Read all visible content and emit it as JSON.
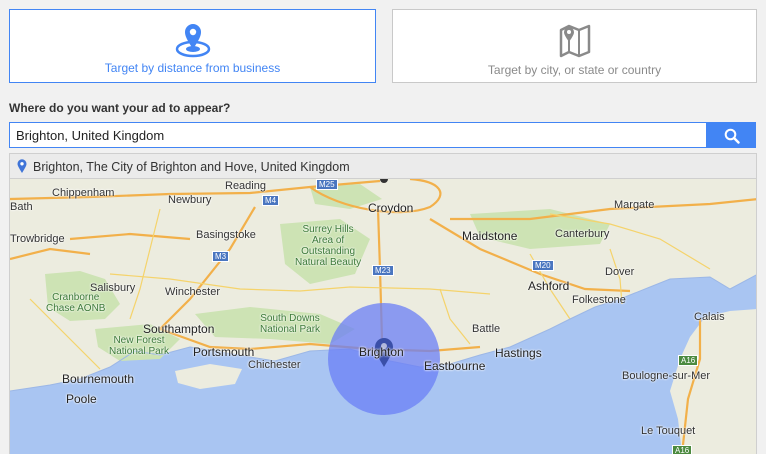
{
  "targeting": {
    "distance_label": "Target by distance from business",
    "city_label": "Target by city, or state or country",
    "active": "distance"
  },
  "question": "Where do you want your ad to appear?",
  "search": {
    "value": "Brighton, United Kingdom",
    "placeholder": ""
  },
  "suggestion": "Brighton, The City of Brighton and Hove, United Kingdom",
  "colors": {
    "accent": "#4285f4",
    "radius_fill": "#6b7ff5",
    "water": "#a9c5f2",
    "land": "#ececdf",
    "park": "#cde3b4"
  },
  "map": {
    "places": {
      "bath": "Bath",
      "chippenham": "Chippenham",
      "newbury": "Newbury",
      "reading": "Reading",
      "croydon": "Croydon",
      "margate": "Margate",
      "trowbridge": "Trowbridge",
      "basingstoke": "Basingstoke",
      "maidstone": "Maidstone",
      "canterbury": "Canterbury",
      "surrey_hills": "Surrey Hills\nArea of\nOutstanding\nNatural Beauty",
      "dover": "Dover",
      "salisbury": "Salisbury",
      "winchester": "Winchester",
      "ashford": "Ashford",
      "folkestone": "Folkestone",
      "cranborne": "Cranborne\nChase AONB",
      "south_downs": "South Downs\nNational Park",
      "battle": "Battle",
      "calais": "Calais",
      "southampton": "Southampton",
      "new_forest": "New Forest\nNational Park",
      "portsmouth": "Portsmouth",
      "brighton": "Brighton",
      "hastings": "Hastings",
      "chichester": "Chichester",
      "eastbourne": "Eastbourne",
      "bournemouth": "Bournemouth",
      "boulogne": "Boulogne-sur-Mer",
      "poole": "Poole",
      "le_touquet": "Le Touquet"
    },
    "roads": {
      "m4": "M4",
      "m25": "M25",
      "m3": "M3",
      "m23": "M23",
      "m20": "M20",
      "a16a": "A16",
      "a16b": "A16"
    }
  }
}
